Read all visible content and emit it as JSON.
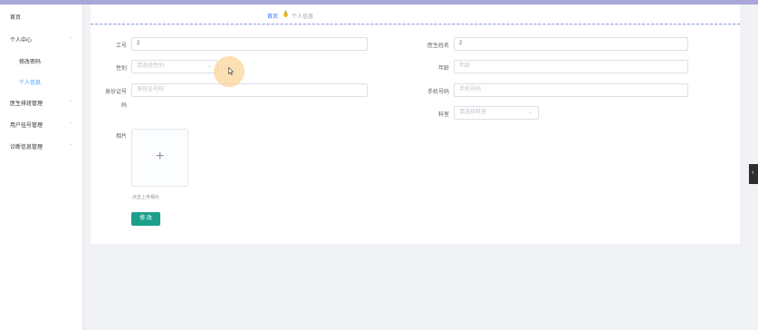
{
  "sidebar": {
    "items": [
      {
        "label": "首页",
        "chevron": false
      },
      {
        "label": "个人中心",
        "chevron": true
      },
      {
        "label": "修改密码",
        "chevron": false
      },
      {
        "label": "个人信息",
        "chevron": false
      },
      {
        "label": "医生排班管理",
        "chevron": true
      },
      {
        "label": "用户挂号管理",
        "chevron": true
      },
      {
        "label": "诊断信息管理",
        "chevron": true
      }
    ],
    "chevron_glyph": "⌄"
  },
  "breadcrumb": {
    "home": "首页",
    "current": "个人信息"
  },
  "form": {
    "gonghao": {
      "label": "工号",
      "value": "2"
    },
    "doctor_name": {
      "label": "医生姓名",
      "value": "2"
    },
    "gender": {
      "label": "性别",
      "placeholder": "请选择性别"
    },
    "age": {
      "label": "年龄",
      "placeholder": "年龄"
    },
    "id_card": {
      "label_line1": "身份证号",
      "label_line2": "码",
      "placeholder": "身份证号码"
    },
    "phone": {
      "label": "手机号码",
      "placeholder": "手机号码"
    },
    "department": {
      "label": "科室",
      "placeholder": "请选择科室"
    },
    "photo": {
      "label": "相片",
      "tip": "点击上传相片"
    },
    "submit_label": "修 改",
    "select_arrow": "⌄"
  },
  "upload_plus": "+",
  "collapse_glyph": "‹",
  "colors": {
    "accent": "#409eff",
    "button": "#1aa08a",
    "top_bar": "#a9a6d8"
  }
}
